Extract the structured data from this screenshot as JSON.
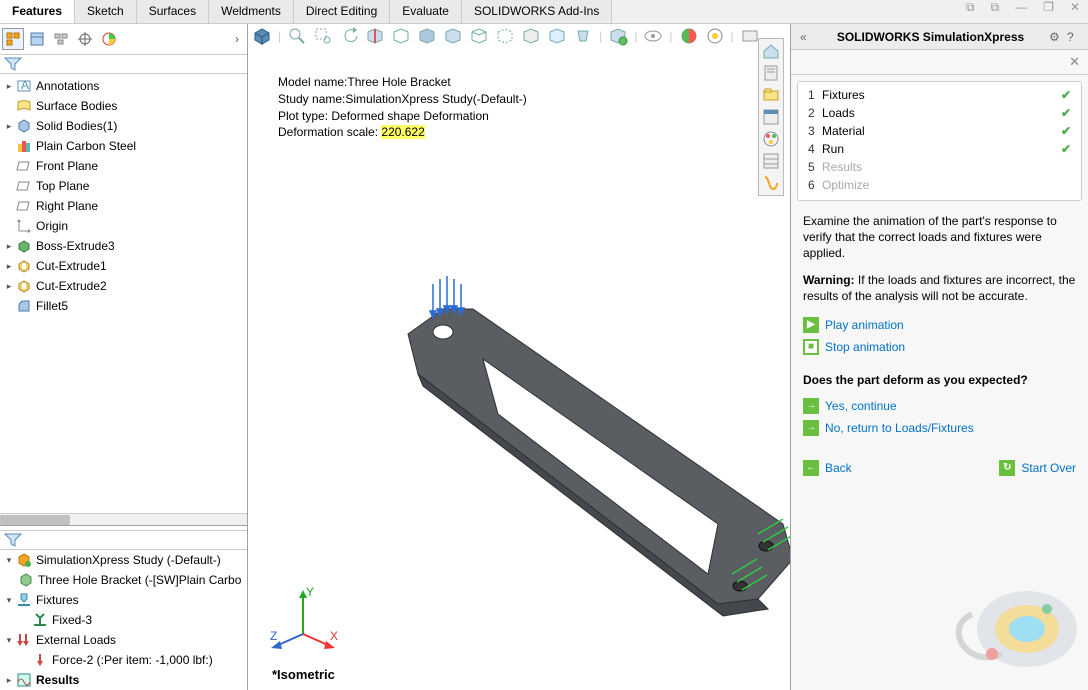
{
  "tabs": [
    "Features",
    "Sketch",
    "Surfaces",
    "Weldments",
    "Direct Editing",
    "Evaluate",
    "SOLIDWORKS Add-Ins"
  ],
  "activeTab": "Features",
  "featureTree": {
    "items": [
      {
        "icon": "annotations",
        "label": "Annotations",
        "toggle": "▸"
      },
      {
        "icon": "surface-bodies",
        "label": "Surface Bodies",
        "toggle": ""
      },
      {
        "icon": "solid-bodies",
        "label": "Solid Bodies(1)",
        "toggle": "▸"
      },
      {
        "icon": "material",
        "label": "Plain Carbon Steel",
        "toggle": ""
      },
      {
        "icon": "plane",
        "label": "Front Plane",
        "toggle": ""
      },
      {
        "icon": "plane",
        "label": "Top Plane",
        "toggle": ""
      },
      {
        "icon": "plane",
        "label": "Right Plane",
        "toggle": ""
      },
      {
        "icon": "origin",
        "label": "Origin",
        "toggle": ""
      },
      {
        "icon": "extrude",
        "label": "Boss-Extrude3",
        "toggle": "▸"
      },
      {
        "icon": "cut",
        "label": "Cut-Extrude1",
        "toggle": "▸"
      },
      {
        "icon": "cut",
        "label": "Cut-Extrude2",
        "toggle": "▸"
      },
      {
        "icon": "fillet",
        "label": "Fillet5",
        "toggle": ""
      }
    ]
  },
  "simTree": {
    "study": "SimulationXpress Study (-Default-)",
    "part": "Three Hole Bracket (-[SW]Plain Carbo",
    "fixtures": "Fixtures",
    "fixed": "Fixed-3",
    "loads": "External Loads",
    "force": "Force-2 (:Per item: -1,000 lbf:)",
    "results": "Results"
  },
  "overlay": {
    "line1a": "Model name:",
    "line1b": "Three Hole Bracket",
    "line2a": "Study name:",
    "line2b": "SimulationXpress Study(-Default-)",
    "line3a": "Plot type: ",
    "line3b": "Deformed shape Deformation",
    "line4a": "Deformation scale: ",
    "line4b": "220.622"
  },
  "viewLabel": "*Isometric",
  "rightPanel": {
    "title": "SOLIDWORKS SimulationXpress",
    "steps": [
      {
        "num": "1",
        "label": "Fixtures",
        "done": true
      },
      {
        "num": "2",
        "label": "Loads",
        "done": true
      },
      {
        "num": "3",
        "label": "Material",
        "done": true
      },
      {
        "num": "4",
        "label": "Run",
        "done": true
      },
      {
        "num": "5",
        "label": "Results",
        "done": false,
        "dim": true
      },
      {
        "num": "6",
        "label": "Optimize",
        "done": false,
        "dim": true
      }
    ],
    "body1": "Examine the animation of the part's response to verify that the correct loads and fixtures were applied.",
    "warnLabel": "Warning:",
    "warnText": " If the loads and fixtures are incorrect, the results of the analysis will not be accurate.",
    "play": "Play animation",
    "stop": "Stop animation",
    "question": "Does the part deform as you expected?",
    "yes": "Yes, continue",
    "no": "No, return to Loads/Fixtures",
    "back": "Back",
    "startOver": "Start Over"
  }
}
